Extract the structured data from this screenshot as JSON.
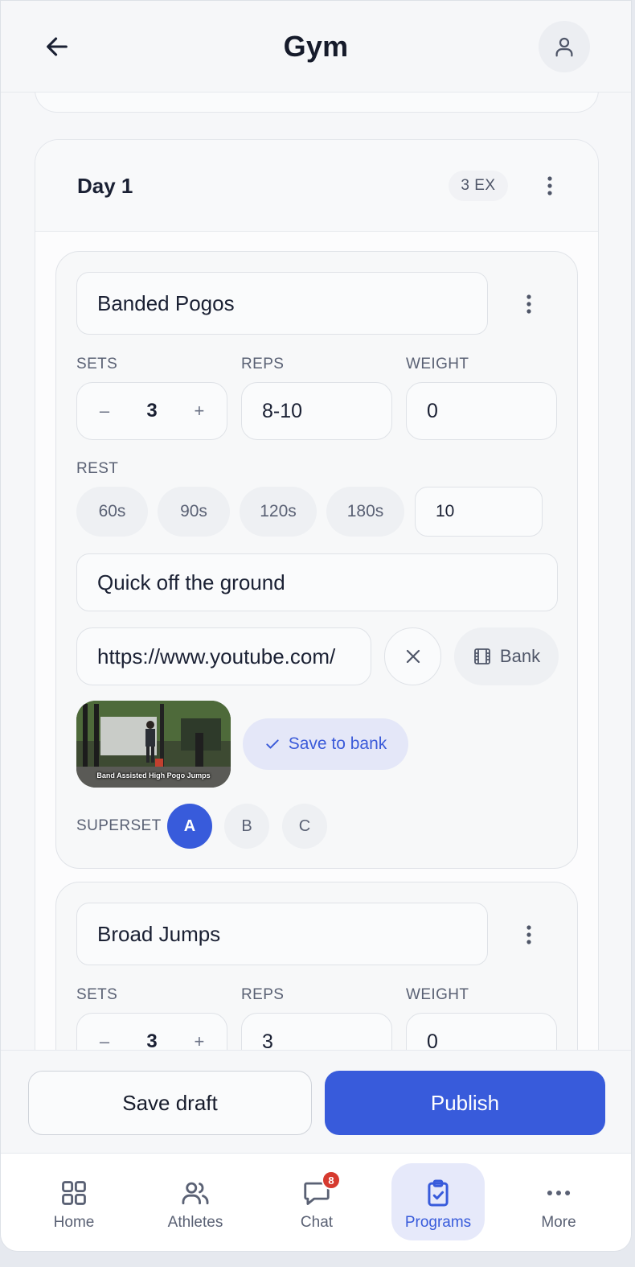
{
  "header": {
    "title": "Gym"
  },
  "day": {
    "title": "Day 1",
    "badge": "3 EX"
  },
  "exercises": [
    {
      "name": "Banded Pogos",
      "sets_label": "SETS",
      "reps_label": "REPS",
      "weight_label": "WEIGHT",
      "sets_value": "3",
      "reps_value": "8-10",
      "weight_value": "0",
      "rest_label": "REST",
      "rest_chips": [
        "60s",
        "90s",
        "120s",
        "180s"
      ],
      "rest_value": "10",
      "notes": "Quick off the ground",
      "video_url": "https://www.youtube.com/",
      "bank_label": "Bank",
      "thumbnail_caption": "Band Assisted High Pogo Jumps",
      "save_bank_label": "Save to bank",
      "superset_label": "SUPERSET",
      "superset_options": [
        "A",
        "B",
        "C"
      ],
      "superset_selected": "A"
    },
    {
      "name": "Broad Jumps",
      "sets_label": "SETS",
      "reps_label": "REPS",
      "weight_label": "WEIGHT",
      "sets_value": "3",
      "reps_value": "3",
      "weight_value": "0"
    }
  ],
  "stepper": {
    "minus": "–",
    "plus": "+"
  },
  "actions": {
    "save_draft": "Save draft",
    "publish": "Publish"
  },
  "nav": {
    "items": [
      {
        "label": "Home",
        "icon": "grid-icon"
      },
      {
        "label": "Athletes",
        "icon": "users-icon"
      },
      {
        "label": "Chat",
        "icon": "chat-icon",
        "badge": "8"
      },
      {
        "label": "Programs",
        "icon": "clipboard-check-icon",
        "active": true
      },
      {
        "label": "More",
        "icon": "more-dots-icon"
      }
    ]
  },
  "colors": {
    "accent": "#385bdb",
    "badge": "#d63a2f",
    "background": "#f6f7f9"
  }
}
